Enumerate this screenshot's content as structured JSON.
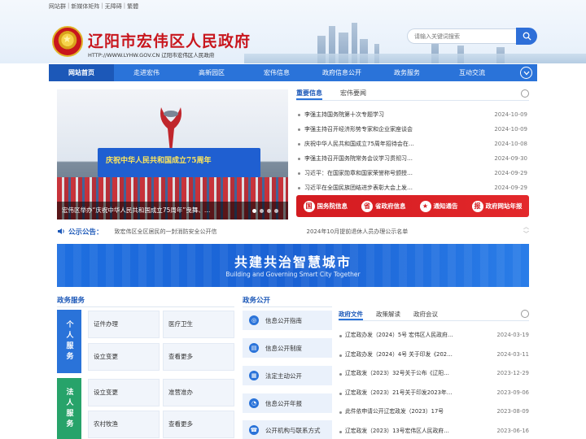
{
  "top_links": [
    "网站群",
    "新媒体矩阵",
    "无障碍",
    "繁體"
  ],
  "header": {
    "title": "辽阳市宏伟区人民政府",
    "url_text": "HTTP://WWW.LYHW.GOV.CN  辽阳市宏伟区人民政府",
    "search_placeholder": "请输入关键词搜索"
  },
  "nav": [
    "网站首页",
    "走进宏伟",
    "高新园区",
    "宏伟信息",
    "政府信息公开",
    "政务服务",
    "互动交流"
  ],
  "carousel": {
    "banner_text": "庆祝中华人民共和国成立75周年",
    "caption": "宏伟区举办“庆祝中华人民共和国成立75周年”曳舞、…"
  },
  "news": {
    "tabs": [
      "重要信息",
      "宏伟要闻"
    ],
    "items": [
      {
        "title": "李强主持国务院第十次专题学习",
        "date": "2024-10-09"
      },
      {
        "title": "李强主持召开经济形势专家和企业家座谈会",
        "date": "2024-10-09"
      },
      {
        "title": "庆祝中华人民共和国成立75周年招待会在…",
        "date": "2024-10-08"
      },
      {
        "title": "李强主持召开国务院常务会议学习贯彻习…",
        "date": "2024-09-30"
      },
      {
        "title": "习近平：在国家勋章和国家荣誉称号颁授…",
        "date": "2024-09-29"
      },
      {
        "title": "习近平在全国民族团结进步表彰大会上发…",
        "date": "2024-09-29"
      }
    ]
  },
  "red_links": [
    {
      "label": "国务院信息",
      "icon": "国"
    },
    {
      "label": "省政府信息",
      "icon": "省"
    },
    {
      "label": "通知通告",
      "icon": "★"
    },
    {
      "label": "政府网站年报",
      "icon": "报"
    }
  ],
  "notice": {
    "label": "公示公告：",
    "items": [
      "致宏伟区全区居民的一封消防安全公开信",
      "2024年10月提前退休人员办理公示名单"
    ]
  },
  "big_banner": {
    "title": "共建共治智慧城市",
    "subtitle": "Building and Governing Smart City Together"
  },
  "services": {
    "title": "政务服务",
    "personal": {
      "label": "个人服务",
      "items": [
        "证件办理",
        "医疗卫生",
        "设立变更",
        "查看更多"
      ]
    },
    "legal": {
      "label": "法人服务",
      "items": [
        "设立变更",
        "准营准办",
        "农村牧渔",
        "查看更多"
      ]
    }
  },
  "gov_public": {
    "title": "政务公开",
    "items": [
      {
        "label": "信息公开指南",
        "icon": "◎"
      },
      {
        "label": "信息公开制度",
        "icon": "▤"
      },
      {
        "label": "法定主动公开",
        "icon": "▦"
      },
      {
        "label": "信息公开年报",
        "icon": "◔"
      },
      {
        "label": "公开机构与联系方式",
        "icon": "☎"
      }
    ]
  },
  "files": {
    "tabs": [
      "政府文件",
      "政策解读",
      "政府会议"
    ],
    "items": [
      {
        "title": "辽宏政办发（2024）5号 宏伟区人民政府…",
        "date": "2024-03-19"
      },
      {
        "title": "辽宏政办发（2024）4号 关于印发《202…",
        "date": "2024-03-11"
      },
      {
        "title": "辽宏政发（2023）32号关于公布《辽阳…",
        "date": "2023-12-29"
      },
      {
        "title": "辽宏政发（2023）21号关于印发2023年…",
        "date": "2023-09-06"
      },
      {
        "title": "此件依申请公开辽宏政发（2023）17号",
        "date": "2023-08-09"
      },
      {
        "title": "辽宏政发（2023）13号宏伟区人民政府…",
        "date": "2023-06-16"
      }
    ]
  }
}
